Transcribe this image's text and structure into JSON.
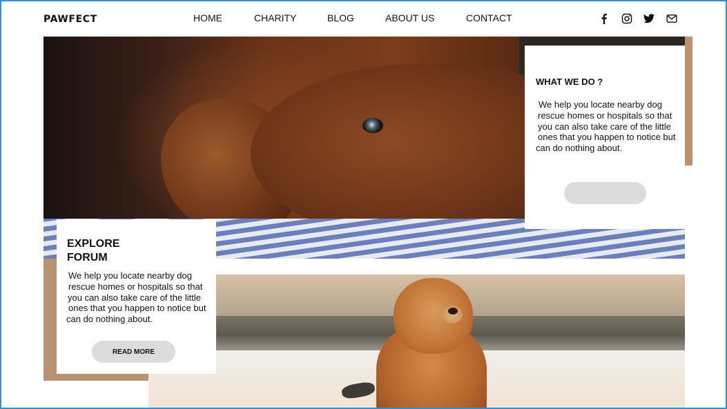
{
  "brand": {
    "logo": "PAWFECT"
  },
  "nav": {
    "items": [
      {
        "label": "HOME"
      },
      {
        "label": "CHARITY"
      },
      {
        "label": "BLOG"
      },
      {
        "label": "ABOUT US"
      },
      {
        "label": "CONTACT"
      }
    ]
  },
  "social": [
    {
      "icon": "facebook-icon"
    },
    {
      "icon": "instagram-icon"
    },
    {
      "icon": "twitter-icon"
    },
    {
      "icon": "mail-icon"
    }
  ],
  "what_we_do": {
    "heading": "WHAT WE DO ?",
    "body_lines": [
      "We help you locate nearby dog",
      "rescue homes or hospitals so that",
      "you can also take care of the little",
      "ones that you happen to notice but",
      "can do nothing about."
    ],
    "button_label": ""
  },
  "explore_forum": {
    "heading_lines": [
      "EXPLORE",
      "FORUM"
    ],
    "body_lines": [
      "We help you locate nearby dog",
      "rescue homes or hospitals so that",
      "you can also take care of the little",
      "ones that you happen to notice but",
      "can do nothing about."
    ],
    "button_label": "READ MORE"
  },
  "colors": {
    "accent": "#b79273",
    "button": "#dcdcdc",
    "frame": "#2f8fd8"
  }
}
